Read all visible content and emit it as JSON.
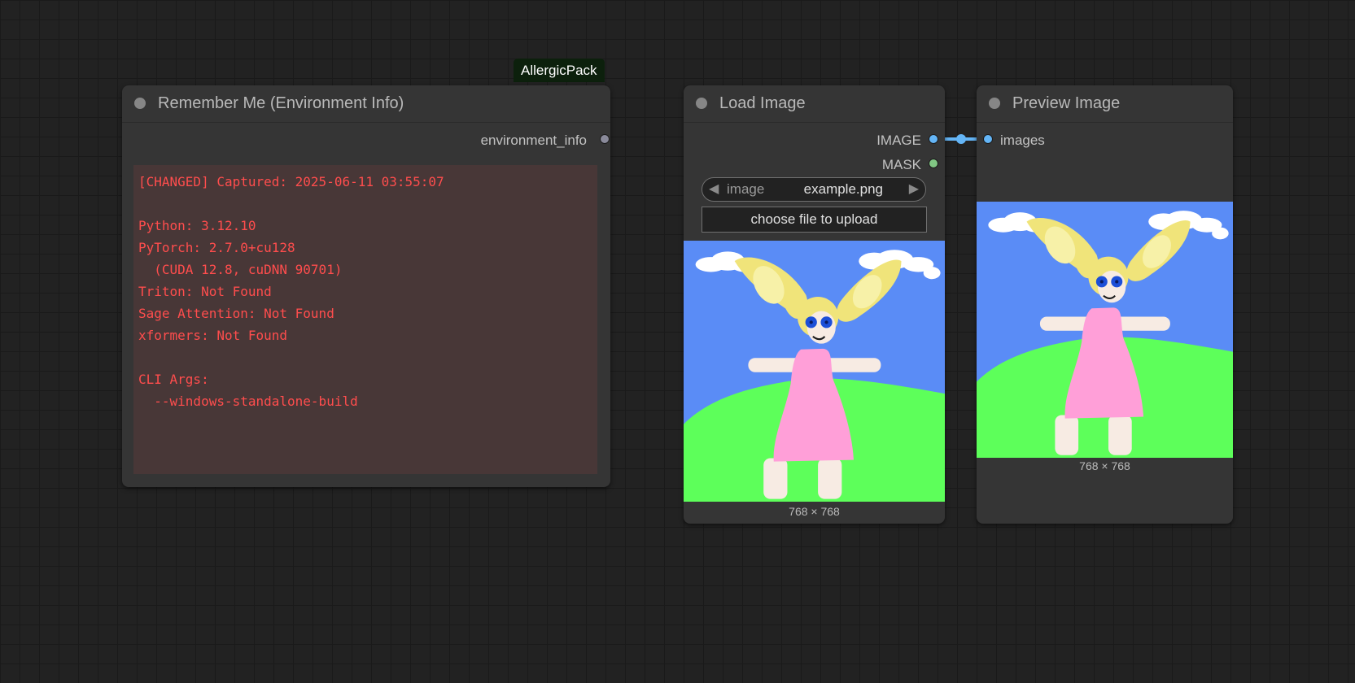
{
  "badge": {
    "label": "AllergicPack"
  },
  "env_node": {
    "title": "Remember Me (Environment Info)",
    "output_label": "environment_info",
    "text": "[CHANGED] Captured: 2025-06-11 03:55:07\n\nPython: 3.12.10\nPyTorch: 2.7.0+cu128\n  (CUDA 12.8, cuDNN 90701)\nTriton: Not Found\nSage Attention: Not Found\nxformers: Not Found\n\nCLI Args:\n  --windows-standalone-build",
    "text_color": "#ff4d4d"
  },
  "load_node": {
    "title": "Load Image",
    "outputs": [
      {
        "label": "IMAGE",
        "color": "#64b5f6"
      },
      {
        "label": "MASK",
        "color": "#81c784"
      }
    ],
    "combo": {
      "name": "image",
      "value": "example.png",
      "prev_arrow": "◀",
      "next_arrow": "▶"
    },
    "upload_label": "choose file to upload",
    "dimensions": "768 × 768"
  },
  "preview_node": {
    "title": "Preview Image",
    "input_label": "images",
    "dimensions": "768 × 768"
  },
  "colors": {
    "canvas": "#222222",
    "node_body": "#353535",
    "image_link": "#64b5f6",
    "mask_slot": "#81c784",
    "env_output_slot": "#8a8a9a"
  }
}
